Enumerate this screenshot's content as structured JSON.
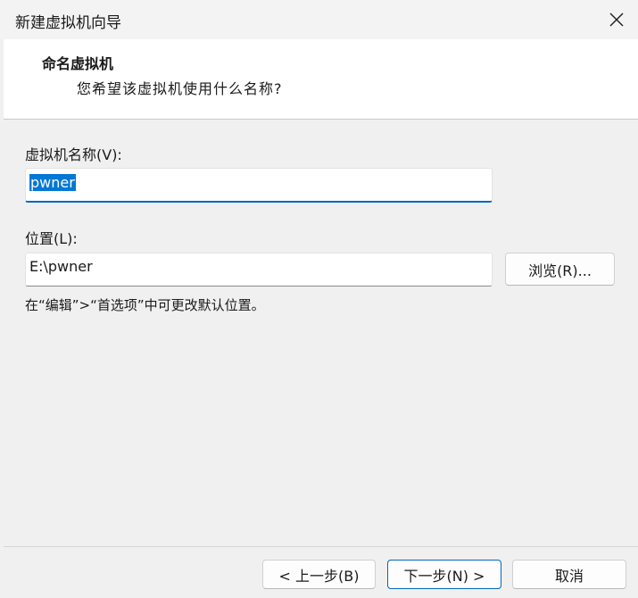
{
  "window": {
    "title": "新建虚拟机向导",
    "close_icon": "close-icon"
  },
  "header": {
    "title": "命名虚拟机",
    "subtitle": "您希望该虚拟机使用什么名称?"
  },
  "vm_name": {
    "label": "虚拟机名称(V):",
    "value": "pwner"
  },
  "location": {
    "label": "位置(L):",
    "value": "E:\\pwner",
    "browse_label": "浏览(R)..."
  },
  "hint": "在“编辑”>“首选项”中可更改默认位置。",
  "footer": {
    "back_label": "< 上一步(B)",
    "next_label": "下一步(N) >",
    "cancel_label": "取消"
  },
  "colors": {
    "accent": "#0067c0",
    "selection": "#0078d4"
  }
}
